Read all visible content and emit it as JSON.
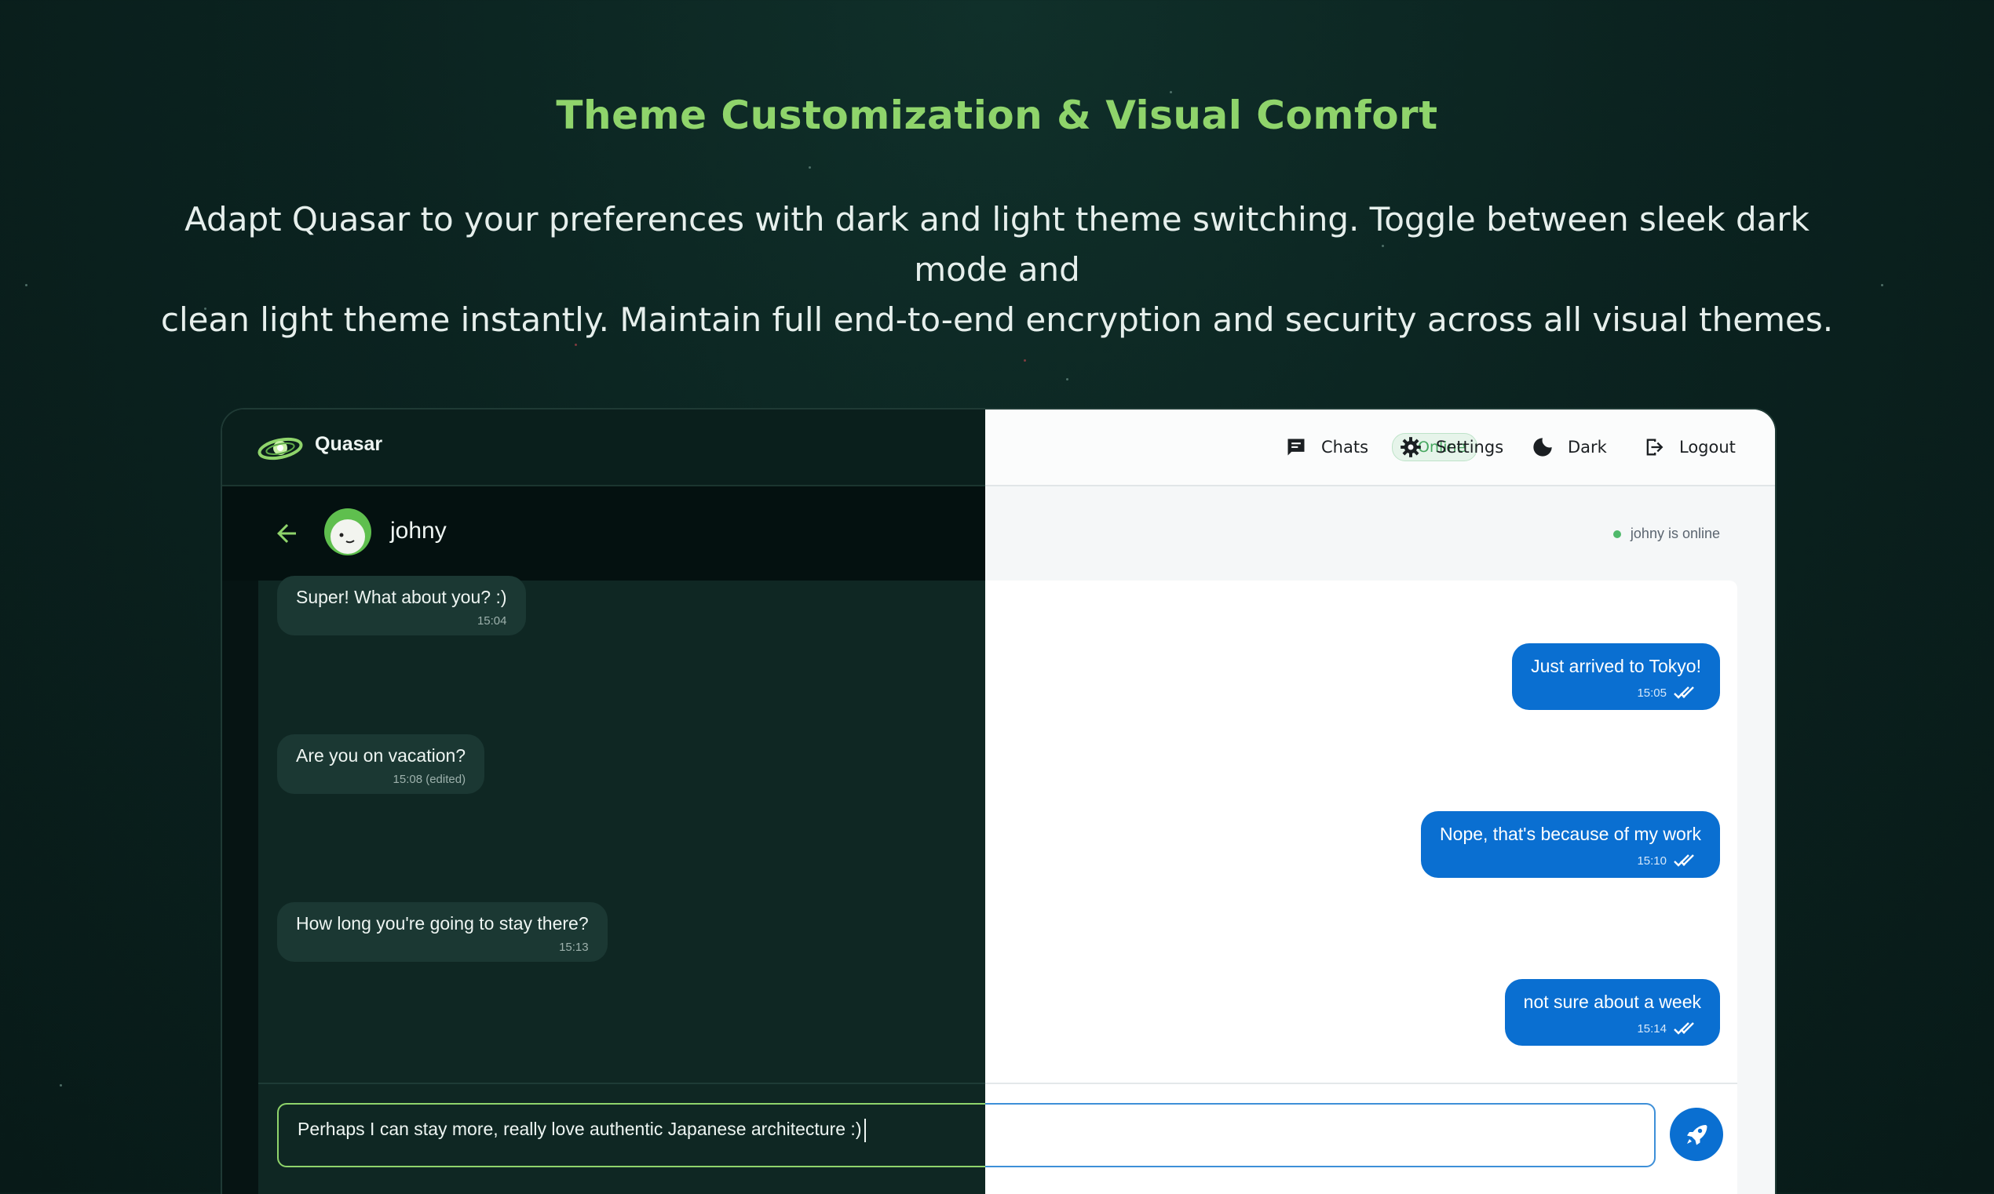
{
  "hero": {
    "title": "Theme Customization & Visual Comfort",
    "description_line1": "Adapt Quasar to your preferences with dark and light theme switching. Toggle between sleek dark mode and",
    "description_line2": "clean light theme instantly. Maintain full end-to-end encryption and security across all visual themes."
  },
  "app": {
    "brand": "Quasar",
    "status": "Online",
    "nav": {
      "chats": "Chats",
      "settings": "Settings",
      "theme": "Dark",
      "logout": "Logout"
    },
    "chat": {
      "contact_name": "johny",
      "online_note": "johny is online",
      "incoming": [
        {
          "text": "Super! What about you? :)",
          "time": "15:04"
        },
        {
          "text": "Are you on vacation?",
          "time": "15:08 (edited)"
        },
        {
          "text": "How long you're going to stay there?",
          "time": "15:13"
        }
      ],
      "outgoing": [
        {
          "text": "Just arrived to Tokyo!",
          "time": "15:05"
        },
        {
          "text": "Nope, that's because of my work",
          "time": "15:10"
        },
        {
          "text": "not sure about a week",
          "time": "15:14"
        }
      ],
      "composer_value": "Perhaps I can stay more, really love authentic Japanese architecture :)"
    },
    "colors": {
      "accent_green": "#8fd46b",
      "accent_blue": "#0a6fd1",
      "dark_bg": "#061413",
      "light_bg": "#f5f7f8"
    },
    "icons": [
      "galaxy-logo-icon",
      "chat-icon",
      "gear-icon",
      "moon-icon",
      "logout-icon",
      "arrow-left-icon",
      "double-check-icon",
      "rocket-icon"
    ]
  }
}
